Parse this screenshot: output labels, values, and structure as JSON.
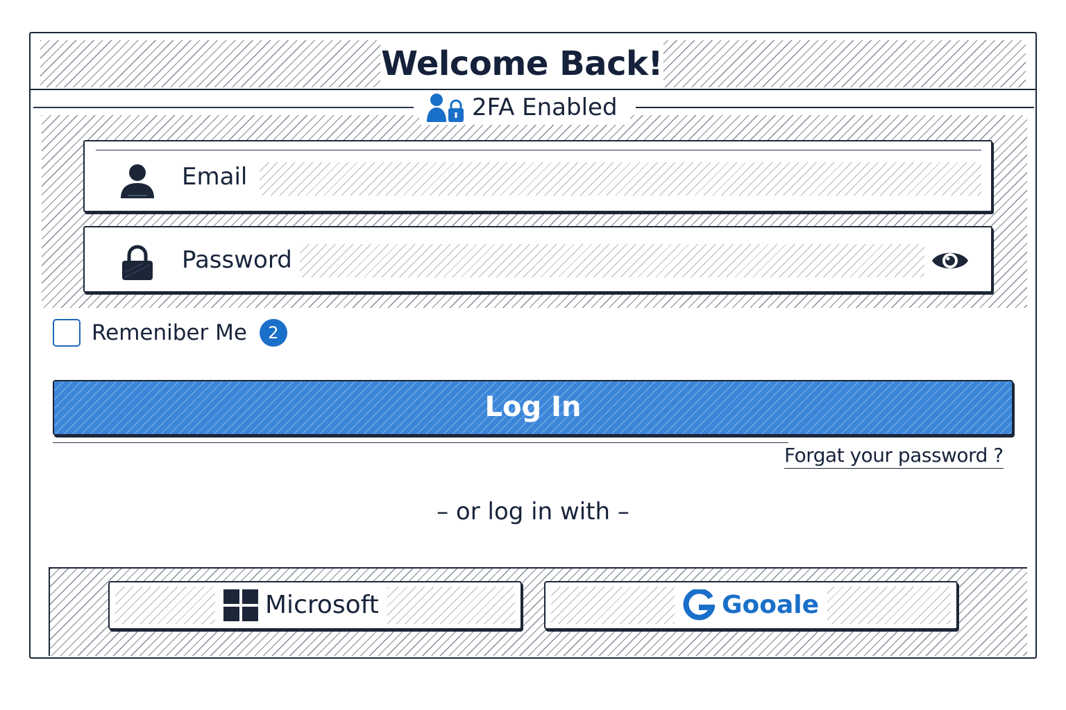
{
  "header": {
    "title": "Welcome Back!",
    "twofa_label": "2FA Enabled",
    "twofa_icon": "user-lock-icon"
  },
  "form": {
    "email": {
      "label": "Email",
      "value": "",
      "icon": "user-icon"
    },
    "password": {
      "label": "Password",
      "value": "",
      "icon": "lock-icon",
      "toggle_icon": "eye-icon"
    },
    "remember": {
      "label": "Remeniber Me",
      "badge": "2",
      "checked": false
    },
    "login_label": "Log In",
    "forgot_label": "Forgat your password ?"
  },
  "divider": {
    "text": "– or log in with –"
  },
  "social": {
    "microsoft": {
      "label": "Microsoft",
      "icon": "windows-logo-icon"
    },
    "google": {
      "label": "Gooale",
      "icon": "google-g-icon"
    }
  },
  "colors": {
    "ink": "#17233a",
    "accent": "#1a6fc9",
    "button": "#3b86d9"
  }
}
